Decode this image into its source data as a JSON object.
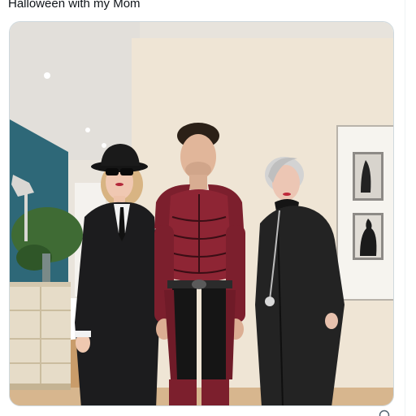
{
  "post": {
    "caption": "Halloween with my Mom"
  },
  "media": {
    "alt": "Photo of three people in Halloween costumes"
  },
  "colors": {
    "caption_text": "#0f1419",
    "media_border": "#cfd9de",
    "wall": "#efe5d6",
    "teal_wall": "#2f6b7a",
    "ceiling": "#e9e6df",
    "armor_red": "#8a2433",
    "coat_black": "#1c1c1e"
  },
  "icons": {
    "corner": "circle-icon"
  }
}
